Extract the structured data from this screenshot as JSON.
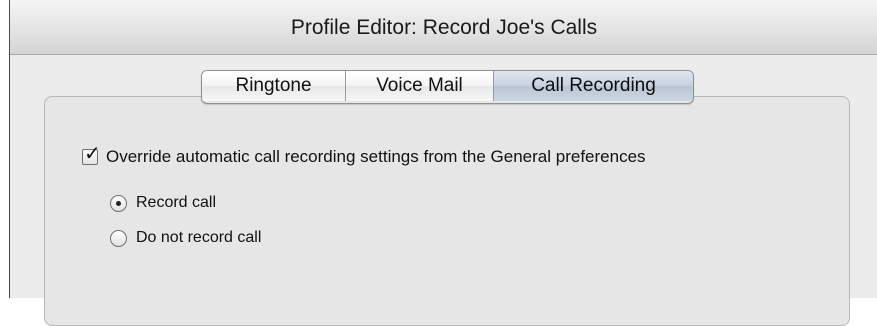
{
  "window": {
    "title": "Profile Editor: Record Joe's Calls"
  },
  "tabs": [
    {
      "label": "Ringtone",
      "active": false
    },
    {
      "label": "Voice Mail",
      "active": false
    },
    {
      "label": "Call Recording",
      "active": true
    }
  ],
  "call_recording": {
    "override_checkbox": {
      "label": "Override automatic call recording settings from the General preferences",
      "checked": true
    },
    "options": [
      {
        "label": "Record call",
        "selected": true
      },
      {
        "label": "Do not record call",
        "selected": false
      }
    ]
  },
  "colors": {
    "window_bg": "#ececec",
    "active_tab": "#c8d2df",
    "border": "#b8b8b8"
  }
}
